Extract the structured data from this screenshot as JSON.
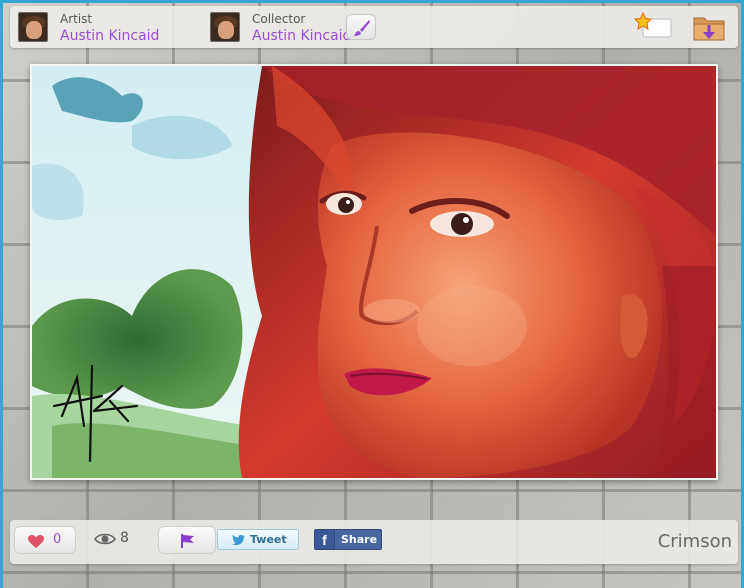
{
  "header": {
    "artist": {
      "role": "Artist",
      "name": "Austin Kincaid"
    },
    "collector": {
      "role": "Collector",
      "name": "Austin Kincaid"
    },
    "icons": {
      "brush": "paintbrush-icon",
      "favorite": "star-favorite-icon",
      "folder": "folder-download-icon"
    }
  },
  "footer": {
    "likes": "0",
    "views": "8",
    "tweet_label": "Tweet",
    "share_label": "Share",
    "facebook_glyph": "f",
    "title": "Crimson"
  },
  "colors": {
    "accent_purple": "#9b4fd2",
    "frame_blue": "#33a7d1",
    "like_heart": "#e05466",
    "facebook_blue": "#3b5998"
  }
}
